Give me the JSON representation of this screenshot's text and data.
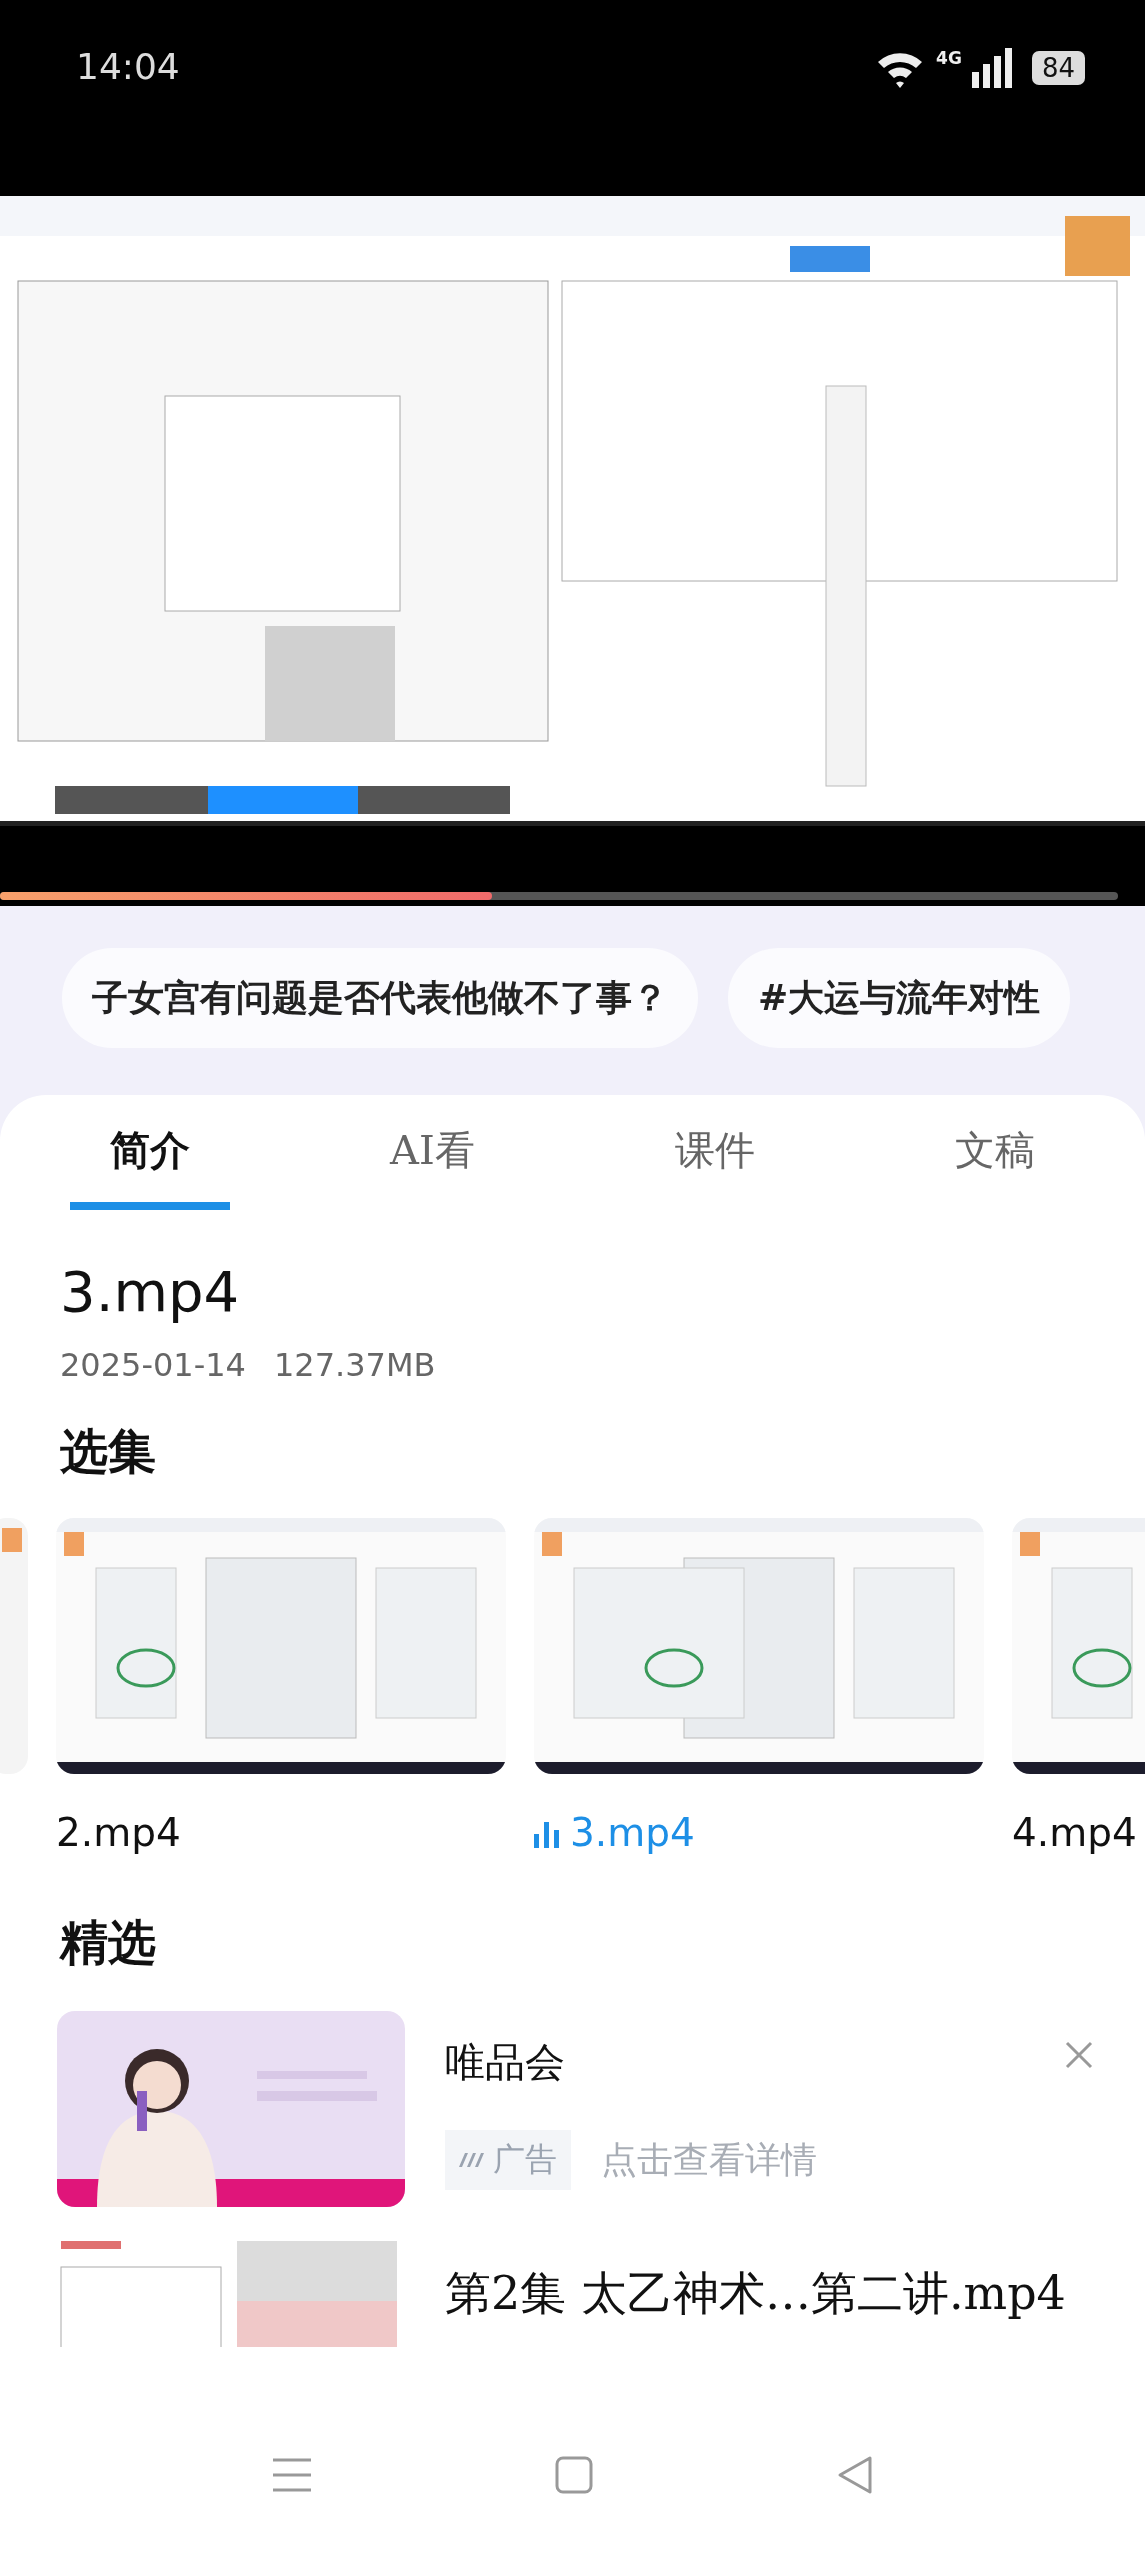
{
  "status_bar": {
    "time": "14:04",
    "network": "4G",
    "battery": "84"
  },
  "player": {
    "progress": {
      "level": 0.44
    }
  },
  "tags": [
    "子女宫有问题是否代表他做不了事？",
    "#大运与流年对性"
  ],
  "tabs": [
    {
      "label": "简介",
      "selected": true
    },
    {
      "label": "AI看",
      "selected": false
    },
    {
      "label": "课件",
      "selected": false
    },
    {
      "label": "文稿",
      "selected": false
    }
  ],
  "video": {
    "title": "3.mp4",
    "date": "2025-01-14",
    "size": "127.37MB"
  },
  "episodes": {
    "heading": "选集",
    "items": [
      {
        "label": "2.mp4",
        "selected": false
      },
      {
        "label": "3.mp4",
        "selected": true
      },
      {
        "label": "4.mp4",
        "selected": false
      }
    ]
  },
  "featured": {
    "heading": "精选",
    "items": [
      {
        "kind": "ad",
        "title": "唯品会",
        "badge": "广告",
        "link": "点击查看详情"
      },
      {
        "kind": "video",
        "title": "第2集 太乙神术…第二讲.mp4"
      }
    ]
  }
}
